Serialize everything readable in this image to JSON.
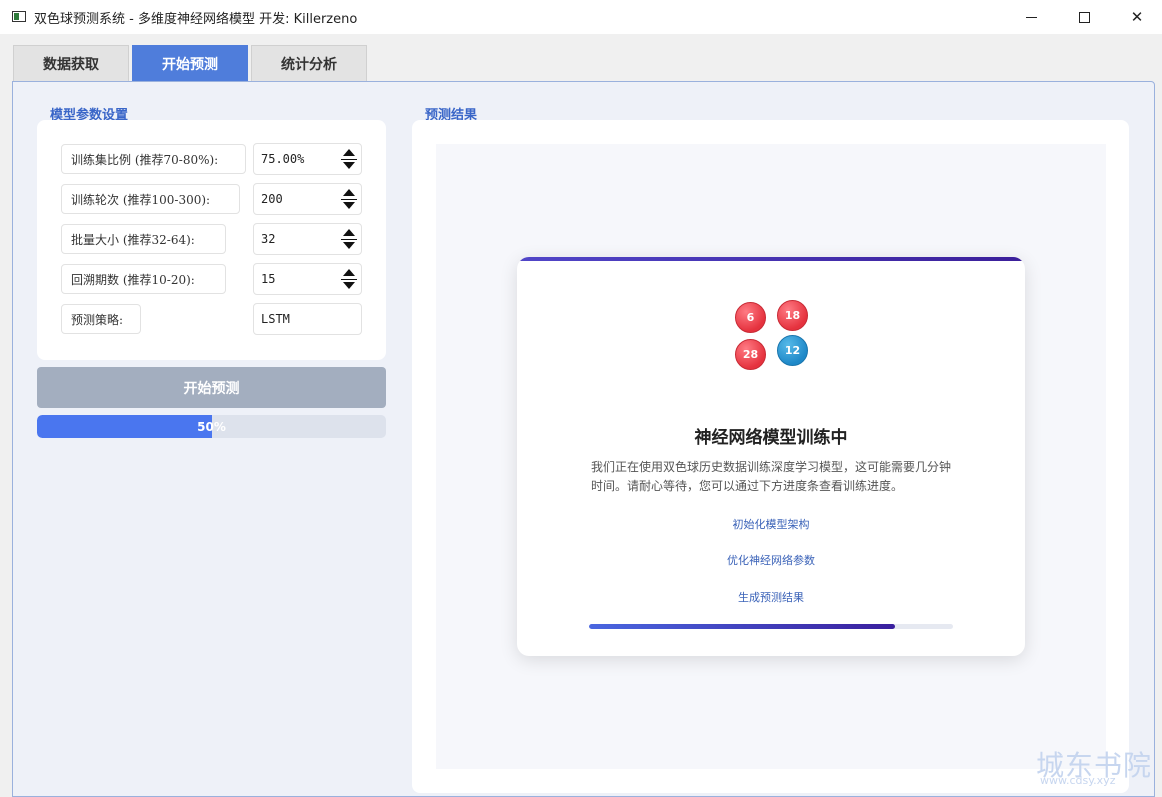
{
  "window": {
    "title": "双色球预测系统 - 多维度神经网络模型 开发: Killerzeno"
  },
  "tabs": [
    {
      "label": "数据获取",
      "active": false
    },
    {
      "label": "开始预测",
      "active": true
    },
    {
      "label": "统计分析",
      "active": false
    }
  ],
  "params": {
    "section_title": "模型参数设置",
    "rows": [
      {
        "label": "训练集比例 (推荐70-80%):",
        "value": "75.00%"
      },
      {
        "label": "训练轮次 (推荐100-300):",
        "value": "200"
      },
      {
        "label": "批量大小 (推荐32-64):",
        "value": "32"
      },
      {
        "label": "回溯期数 (推荐10-20):",
        "value": "15"
      },
      {
        "label": "预测策略:",
        "value": "LSTM"
      }
    ],
    "start_button": "开始预测",
    "progress_text": "50%",
    "progress_value": 0.5
  },
  "results": {
    "section_title": "预测结果",
    "balls": [
      {
        "number": "6",
        "color": "red"
      },
      {
        "number": "18",
        "color": "red"
      },
      {
        "number": "28",
        "color": "red"
      },
      {
        "number": "12",
        "color": "blue"
      }
    ],
    "title": "神经网络模型训练中",
    "description": "我们正在使用双色球历史数据训练深度学习模型，这可能需要几分钟时间。请耐心等待，您可以通过下方进度条查看训练进度。",
    "steps": [
      "初始化模型架构",
      "优化神经网络参数",
      "生成预测结果"
    ],
    "progress_value": 0.84
  },
  "watermark": {
    "text": "城东书院",
    "sub": "www.cdsy.xyz"
  },
  "colors": {
    "accent": "#4f7ddb",
    "progress": "#4a76ef",
    "red_ball": "#e5323e",
    "blue_ball": "#1e88c8"
  }
}
